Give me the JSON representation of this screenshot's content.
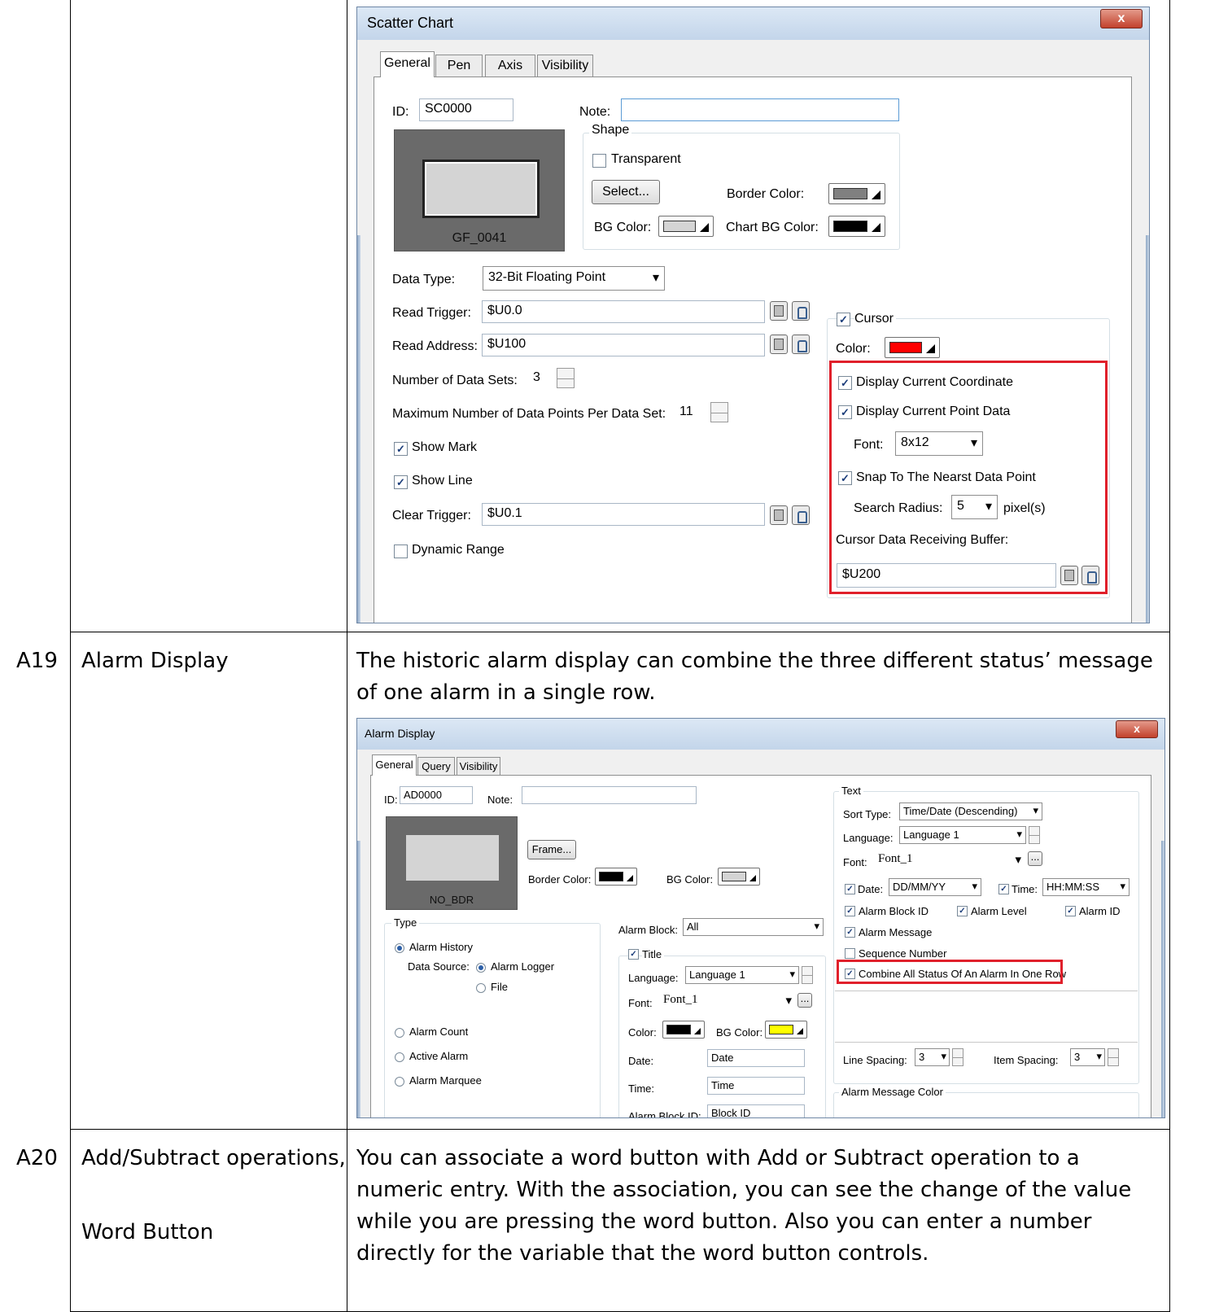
{
  "scatter": {
    "title": "Scatter Chart",
    "close": "x",
    "tabs": [
      "General",
      "Pen",
      "Axis",
      "Visibility"
    ],
    "id_label": "ID:",
    "id_value": "SC0000",
    "note_label": "Note:",
    "note_value": "",
    "shape_label": "Shape",
    "transparent_label": "Transparent",
    "select_label": "Select...",
    "border_color_label": "Border Color:",
    "bg_color_label": "BG Color:",
    "chart_bg_color_label": "Chart BG Color:",
    "preview_name": "GF_0041",
    "data_type_label": "Data Type:",
    "data_type_value": "32-Bit Floating Point",
    "read_trigger_label": "Read Trigger:",
    "read_trigger_value": "$U0.0",
    "read_address_label": "Read Address:",
    "read_address_value": "$U100",
    "num_sets_label": "Number of Data Sets:",
    "num_sets_value": "3",
    "max_points_label": "Maximum Number of Data Points Per Data Set:",
    "max_points_value": "11",
    "show_mark_label": "Show Mark",
    "show_line_label": "Show Line",
    "clear_trigger_label": "Clear Trigger:",
    "clear_trigger_value": "$U0.1",
    "dynamic_range_label": "Dynamic Range",
    "cursor_label": "Cursor",
    "color_label": "Color:",
    "display_coord_label": "Display Current Coordinate",
    "display_point_label": "Display Current Point Data",
    "font_label": "Font:",
    "font_value": "8x12",
    "snap_label": "Snap To The Nearst Data Point",
    "search_radius_label": "Search Radius:",
    "search_radius_value": "5",
    "pixels_label": "pixel(s)",
    "buffer_label": "Cursor Data Receiving Buffer:",
    "buffer_value": "$U200",
    "colors": {
      "border": "#808080",
      "bg": "#d4d4d4",
      "chart_bg": "#000000",
      "cursor": "#ff0000"
    }
  },
  "rows": [
    {
      "id": "A19",
      "name": "Alarm Display",
      "desc": "The historic alarm display can combine the three different status’ message of one alarm in a single row."
    },
    {
      "id": "A20",
      "name_line1": "Add/Subtract operations,",
      "name_line2": "Word Button",
      "desc": "You can associate a word button with Add or Subtract operation to a numeric entry. With the association, you can see the change of the value while you are pressing the word button. Also you can enter a number directly for the variable that the word button controls."
    }
  ],
  "alarm": {
    "title": "Alarm Display",
    "close": "x",
    "tabs": [
      "General",
      "Query",
      "Visibility"
    ],
    "id_label": "ID:",
    "id_value": "AD0000",
    "note_label": "Note:",
    "frame_label": "Frame...",
    "border_color_label": "Border Color:",
    "bg_color_label": "BG Color:",
    "preview_name": "NO_BDR",
    "type_label": "Type",
    "alarm_history": "Alarm History",
    "data_source_label": "Data Source:",
    "alarm_logger": "Alarm Logger",
    "file": "File",
    "alarm_count": "Alarm Count",
    "active_alarm": "Active Alarm",
    "alarm_marquee": "Alarm Marquee",
    "alarm_block_label": "Alarm Block:",
    "alarm_block_value": "All",
    "title_cb": "Title",
    "language_label": "Language:",
    "language_value": "Language 1",
    "font_label": "Font:",
    "font_value": "Font_1",
    "color_label": "Color:",
    "bg_color2_label": "BG Color:",
    "date_label": "Date:",
    "date_value": "Date",
    "time_label": "Time:",
    "time_value": "Time",
    "block_id_label": "Alarm Block ID:",
    "block_id_value": "Block ID",
    "text_label": "Text",
    "sort_type_label": "Sort Type:",
    "sort_type_value": "Time/Date (Descending)",
    "t_language_label": "Language:",
    "t_language_value": "Language 1",
    "t_font_label": "Font:",
    "t_font_value": "Font_1",
    "t_date_label": "Date:",
    "t_date_value": "DD/MM/YY",
    "t_time_label": "Time:",
    "t_time_value": "HH:MM:SS",
    "alarm_block_id_cb": "Alarm Block ID",
    "alarm_level_cb": "Alarm Level",
    "alarm_id_cb": "Alarm ID",
    "alarm_message_cb": "Alarm Message",
    "sequence_number_cb": "Sequence Number",
    "combine_cb": "Combine All Status Of An Alarm In One Row",
    "line_spacing_label": "Line Spacing:",
    "line_spacing_value": "3",
    "item_spacing_label": "Item Spacing:",
    "item_spacing_value": "3",
    "msg_color_label": "Alarm Message Color",
    "colors": {
      "border": "#000000",
      "bg": "#d4d4d4",
      "title_color": "#000000",
      "title_bg": "#ffff00"
    }
  }
}
